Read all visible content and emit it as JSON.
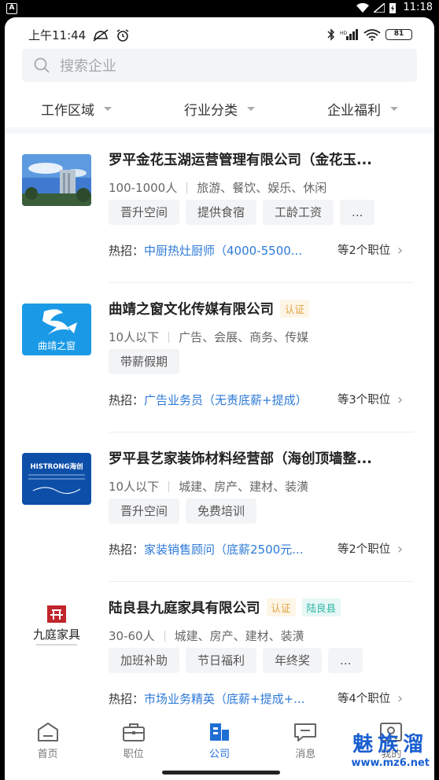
{
  "system_bar": {
    "time": "11:18"
  },
  "status": {
    "time": "上午11:44",
    "battery": "81"
  },
  "search": {
    "placeholder": "搜索企业"
  },
  "filters": [
    "工作区域",
    "行业分类",
    "企业福利"
  ],
  "companies": [
    {
      "name": "罗平金花玉湖运营管理有限公司（金花玉...",
      "size": "100-1000人",
      "industry": "旅游、餐饮、娱乐、休闲",
      "tags": [
        "晋升空间",
        "提供食宿",
        "工龄工资",
        "..."
      ],
      "hot_label": "热招：",
      "hot_job": "中厨热灶厨师（4000-5500...",
      "more": "等2个职位"
    },
    {
      "name": "曲靖之窗文化传媒有限公司",
      "cert": "认证",
      "logo_text": "曲靖之窗",
      "size": "10人以下",
      "industry": "广告、会展、商务、传媒",
      "tags": [
        "带薪假期"
      ],
      "hot_label": "热招：",
      "hot_job": "广告业务员（无责底薪+提成）",
      "more": "等3个职位"
    },
    {
      "name": "罗平县艺家装饰材料经营部（海创顶墙整...",
      "logo_text": "HISTRONG海创",
      "size": "10人以下",
      "industry": "城建、房产、建材、装潢",
      "tags": [
        "晋升空间",
        "免费培训"
      ],
      "hot_label": "热招：",
      "hot_job": "家装销售顾问（底薪2500元...",
      "more": "等2个职位"
    },
    {
      "name": "陆良县九庭家具有限公司",
      "cert": "认证",
      "area": "陆良县",
      "logo_text": "九庭家具",
      "size": "30-60人",
      "industry": "城建、房产、建材、装潢",
      "tags": [
        "加班补助",
        "节日福利",
        "年终奖",
        "..."
      ],
      "hot_label": "热招：",
      "hot_job": "市场业务精英（底薪+提成+...",
      "more": "等4个职位"
    }
  ],
  "tabbar": [
    {
      "label": "首页",
      "icon": "home-icon"
    },
    {
      "label": "职位",
      "icon": "briefcase-icon"
    },
    {
      "label": "公司",
      "icon": "building-icon",
      "active": true
    },
    {
      "label": "消息",
      "icon": "message-icon"
    },
    {
      "label": "我的",
      "icon": "profile-icon"
    }
  ],
  "watermark": {
    "cn": "魅族溜",
    "url": "www.mz6.net"
  },
  "colors": {
    "accent": "#1f6ed4",
    "link": "#2e7ad8",
    "cert": "#e0a040",
    "area": "#2cb5a5"
  }
}
